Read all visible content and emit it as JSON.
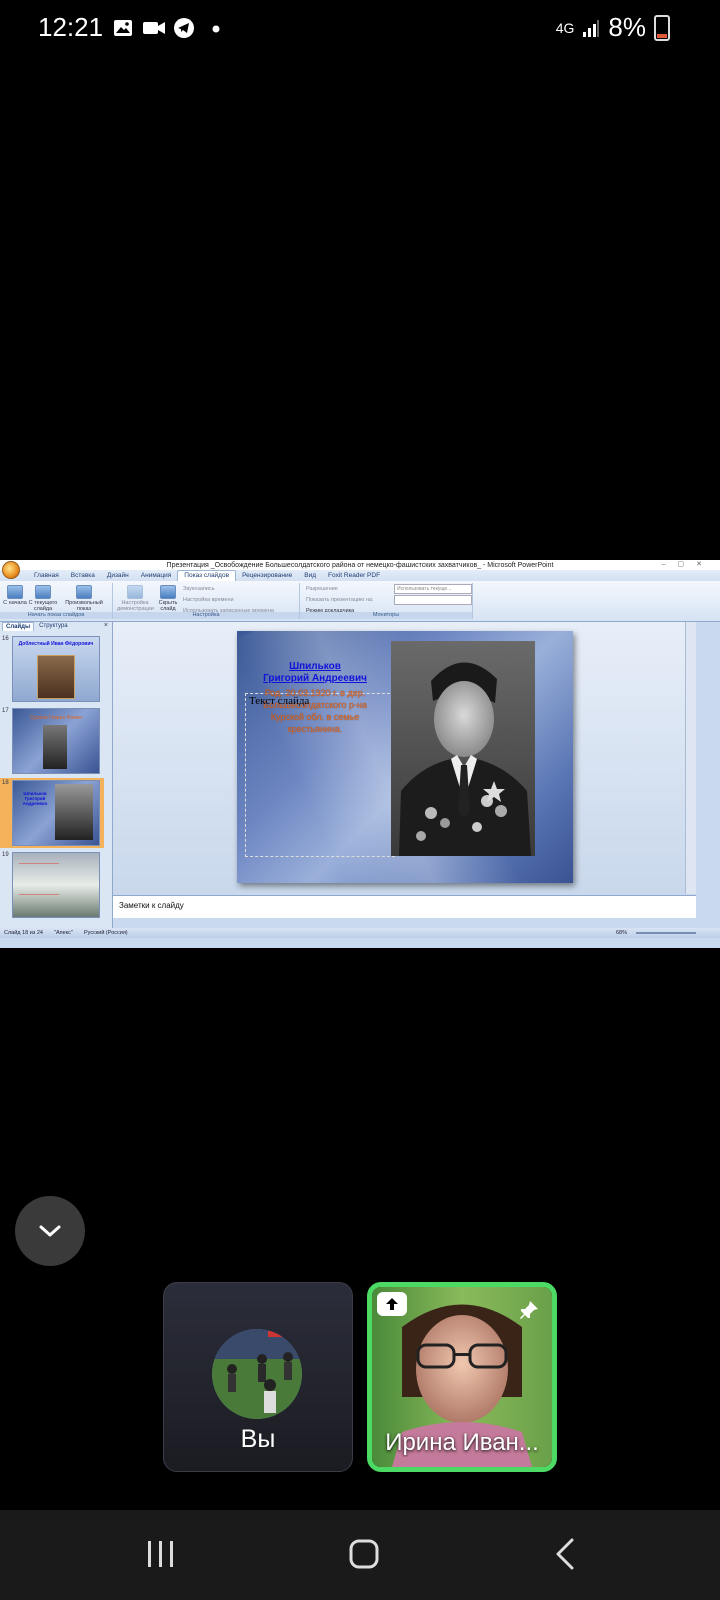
{
  "status_bar": {
    "time": "12:21",
    "network": "4G",
    "battery": "8%",
    "left_icons": [
      "gallery-icon",
      "video-call-icon",
      "telegram-icon",
      "dot-icon"
    ]
  },
  "powerpoint": {
    "window_title": "Презентация _Освобождение Большесолдатского района от немецко-фашистских захватчиков_ - Microsoft PowerPoint",
    "tabs": [
      "Главная",
      "Вставка",
      "Дизайн",
      "Анимация",
      "Показ слайдов",
      "Рецензирование",
      "Вид",
      "Foxit Reader PDF"
    ],
    "active_tab": "Показ слайдов",
    "ribbon": {
      "group1_label": "Начать показ слайдов",
      "from_start": "С начала",
      "from_current": "С текущего слайда",
      "custom_show": "Произвольный показ",
      "group2_label": "Настройка",
      "setup_show": "Настройка демонстрации",
      "hide_slide": "Скрыть слайд",
      "record": "Звукозапись",
      "rehearse": "Настройка времени",
      "use_timings": "Использовать записанные времена",
      "group3_label": "Мониторы",
      "resolution": "Разрешение",
      "resolution_value": "Использовать текуще...",
      "show_on": "Показать презентацию на:",
      "presenter_view": "Режим докладчика"
    },
    "pane_tabs": [
      "Слайды",
      "Структура"
    ],
    "pane_close": "×",
    "thumbnails": [
      {
        "num": "16",
        "title": "Доблестный Иван Фёдорович"
      },
      {
        "num": "17",
        "title": "Сушков Гаврил Фомич"
      },
      {
        "num": "18",
        "title": "Шпильков Григорий Андреевич"
      },
      {
        "num": "19",
        "title": ""
      }
    ],
    "selected_slide": "18",
    "slide": {
      "name_line1": "Шпильков",
      "name_line2": "Григорий Андреевич",
      "placeholder": "Текст слайда",
      "body": "Род. 20.03.1920 г. в дер. Большесолдатского р-на Курской обл. в семье крестьянина."
    },
    "notes_placeholder": "Заметки к слайду",
    "statusbar": {
      "slide_info": "Слайд 18 из 24",
      "theme": "\"Апекс\"",
      "language": "Русский (Россия)",
      "zoom": "68%"
    }
  },
  "call": {
    "self_label": "Вы",
    "participant_label": "Ирина Иван...",
    "accent_color": "#4cd964"
  },
  "navbar": {
    "buttons": [
      "recent-apps",
      "home",
      "back"
    ]
  }
}
